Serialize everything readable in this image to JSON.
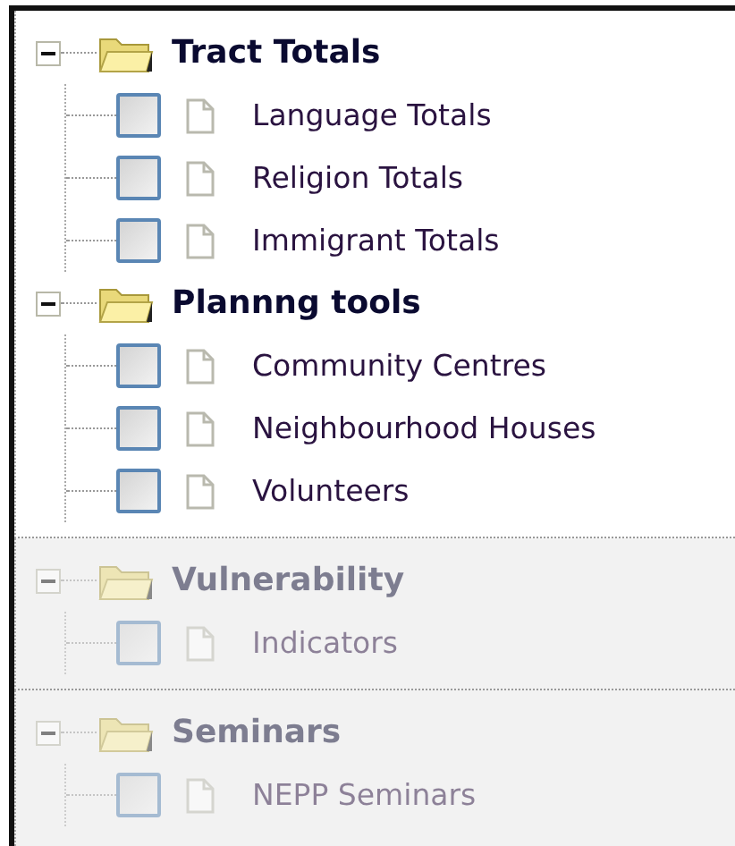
{
  "panels": [
    {
      "disabled": false,
      "groups": [
        {
          "title": "Tract Totals",
          "expanded": true,
          "items": [
            {
              "label": "Language Totals",
              "checked": false
            },
            {
              "label": "Religion Totals",
              "checked": false
            },
            {
              "label": "Immigrant Totals",
              "checked": false
            }
          ]
        },
        {
          "title": "Plannng tools",
          "expanded": true,
          "items": [
            {
              "label": "Community Centres",
              "checked": false
            },
            {
              "label": "Neighbourhood Houses",
              "checked": false
            },
            {
              "label": "Volunteers",
              "checked": false
            }
          ]
        }
      ]
    },
    {
      "disabled": true,
      "groups": [
        {
          "title": "Vulnerability",
          "expanded": true,
          "items": [
            {
              "label": "Indicators",
              "checked": false
            }
          ]
        }
      ]
    },
    {
      "disabled": true,
      "groups": [
        {
          "title": "Seminars",
          "expanded": true,
          "items": [
            {
              "label": "NEPP Seminars",
              "checked": false
            }
          ]
        }
      ]
    }
  ]
}
